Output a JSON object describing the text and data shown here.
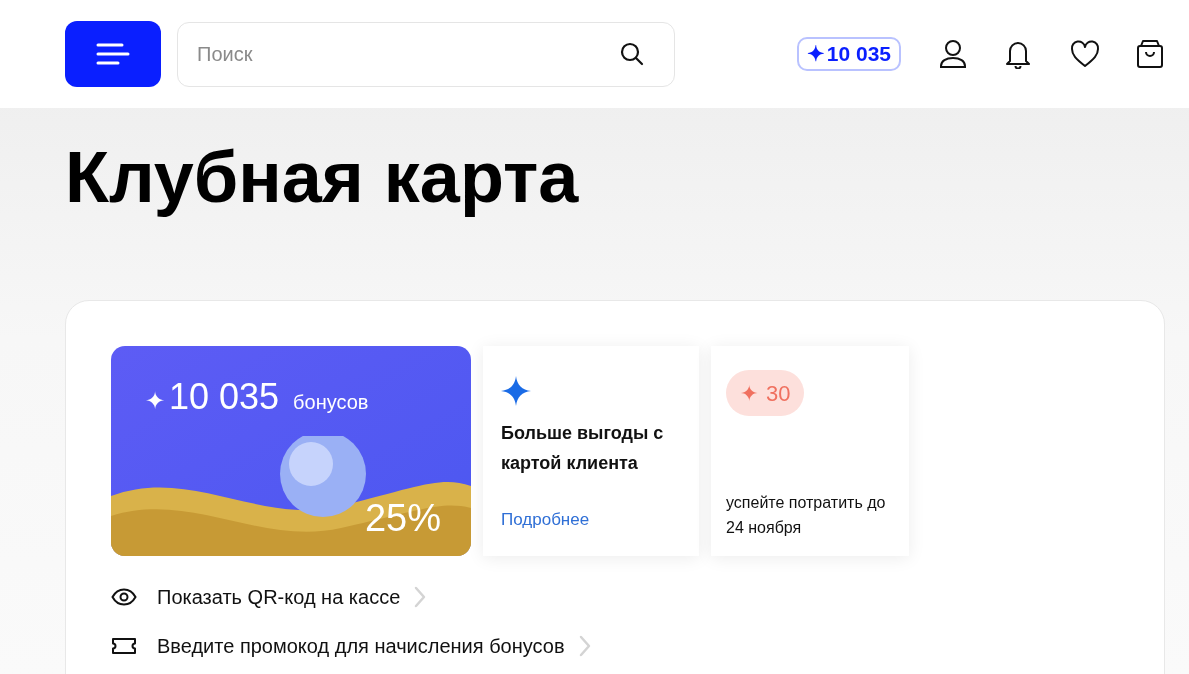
{
  "header": {
    "search": {
      "placeholder": "Поиск"
    },
    "bonus_badge": {
      "icon": "✦",
      "value": "10 035"
    }
  },
  "title": "Клубная карта",
  "bonus_card": {
    "icon": "✦",
    "value": "10 035",
    "unit": "бонусов",
    "percent": "25%"
  },
  "promo_card": {
    "title": "Больше выгоды с картой клиента",
    "link": "Подробнее"
  },
  "expiring_card": {
    "icon": "✦",
    "value": "30",
    "note": "успейте потратить до 24 ноября"
  },
  "actions": [
    {
      "kind": "qr",
      "label": "Показать QR-код на кассе"
    },
    {
      "kind": "promo",
      "label": "Введите промокод для начисления бонусов"
    }
  ]
}
